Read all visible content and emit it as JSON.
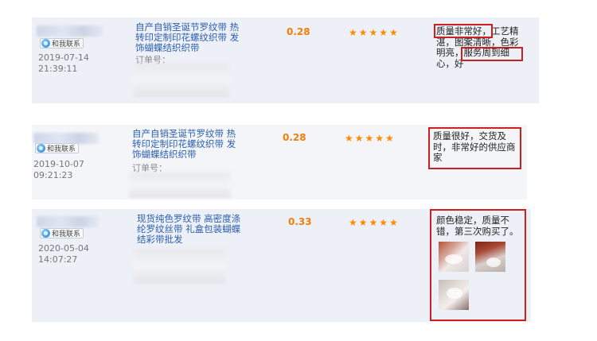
{
  "contact_label": "和我联系",
  "colors": {
    "row_bg": "#eef0f7",
    "price": "#f07f09",
    "stars": "#ff8a00",
    "highlight": "#cc1f1f",
    "link": "#2a5fae"
  },
  "icons": {
    "contact": "chat-bubble-icon",
    "star": "star-icon"
  },
  "reviews": [
    {
      "date": "2019-07-14",
      "time": "21:39:11",
      "product_lines": [
        "自产自销圣诞节罗纹带 热",
        "转印定制印花螺纹织带 发",
        "饰蝴蝶结织织带"
      ],
      "order_label": "订单号：",
      "price": "0.28",
      "rating": 5,
      "stars": "★★★★★",
      "review_lines": [
        "质量非常好，工艺精",
        "湛，图案清晰，色彩",
        "明亮，服务周到细",
        "心，好"
      ],
      "highlight_1": "质量非常好",
      "highlight_2": "服务周到细"
    },
    {
      "date": "2019-10-07",
      "time": "09:21:23",
      "product_lines": [
        "自产自销圣诞节罗纹带 热",
        "转印定制印花螺纹织带 发",
        "饰蝴蝶结织织带"
      ],
      "order_label": "订单号：",
      "price": "0.28",
      "rating": 5,
      "stars": "★★★★★",
      "review_lines": [
        "质量很好，交货及",
        "时，非常好的供应商",
        "家"
      ]
    },
    {
      "date": "2020-05-04",
      "time": "14:07:27",
      "product_lines": [
        "现货纯色罗纹带 高密度涤",
        "纶罗纹丝带 礼盒包装蝴蝶",
        "结彩带批发"
      ],
      "price": "0.33",
      "rating": 5,
      "stars": "★★★★★",
      "review_lines": [
        "颜色稳定，质量不",
        "错，第三次购买了。"
      ],
      "photos": 3
    }
  ]
}
